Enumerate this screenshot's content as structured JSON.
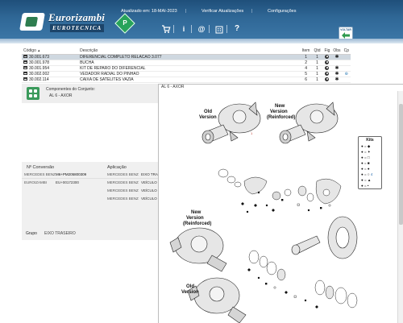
{
  "header": {
    "brand_name": "Eurorizambi",
    "brand_tagline": "EUROTECNICA",
    "updated_label": "Atualizado em: 18-MAI-2023",
    "check_updates": "Verificar Atualizações",
    "settings": "Configurações",
    "back_label": "VOLTAR",
    "toolbar_icons": [
      "cart-icon",
      "info-icon",
      "at-icon",
      "building-icon",
      "help-icon"
    ]
  },
  "parts_table": {
    "columns": [
      "Código",
      "Descrição",
      "Item",
      "Qtd",
      "Fig",
      "Obs",
      "Cp"
    ],
    "sort_indicator": "▲",
    "rows": [
      {
        "code": "30.001.673",
        "description": "DIFERENCIAL COMPLETO RELACAO 3.077",
        "item": "1",
        "qty": "1",
        "selected": true
      },
      {
        "code": "30.001.978",
        "description": "BUCHA",
        "item": "2",
        "qty": "1",
        "selected": false
      },
      {
        "code": "30.001.954",
        "description": "KIT DE REPARO DO DIFERENCIAL",
        "item": "4",
        "qty": "1",
        "selected": false
      },
      {
        "code": "30.002.002",
        "description": "VEDADOR RADIAL DO PINHAO",
        "item": "5",
        "qty": "1",
        "selected": false
      },
      {
        "code": "30.002.114",
        "description": "CAIXA DE SATELITES VAZIA",
        "item": "6",
        "qty": "1",
        "selected": false
      }
    ]
  },
  "component": {
    "title": "Componentes do Conjunto:",
    "value": "AL 6 - AXOR"
  },
  "conversions": {
    "col_conv": "Nº Conversão",
    "col_app": "Aplicação",
    "rows": [
      {
        "brand": "MERCEDES BENZ",
        "number": "M6+PM205800309"
      },
      {
        "brand": "EUROIZAMBI",
        "number": "EU+00172300"
      }
    ],
    "applications": [
      {
        "brand": "MERCEDES BENZ",
        "model": "EIXO TRAS"
      },
      {
        "brand": "MERCEDES BENZ",
        "model": "VEÍCULO"
      },
      {
        "brand": "MERCEDES BENZ",
        "model": "VEÍCULO"
      },
      {
        "brand": "MERCEDES BENZ",
        "model": "VEÍCULO"
      }
    ],
    "group_label": "Grupo",
    "group_value": "EIXO TRASEIRO"
  },
  "diagram": {
    "title": "AL 6 - AXOR",
    "labels": {
      "old_top": [
        "Old",
        "Version"
      ],
      "new_top": [
        "New",
        "Version",
        "(Reinforced)"
      ],
      "new_mid": [
        "New",
        "Version",
        "(Reinforced)"
      ],
      "old_bottom": [
        "Old",
        "Version"
      ]
    },
    "kits": {
      "title": "Kits",
      "entries": [
        "◆",
        "✦",
        "□",
        "■",
        "●",
        "○",
        "▲",
        "•"
      ],
      "number_label": "4"
    }
  },
  "colors": {
    "header_top": "#1f4f7a",
    "header_bottom": "#3b76a6",
    "selected_row": "#cfd8e0",
    "accent_green": "#3a9a5b"
  }
}
